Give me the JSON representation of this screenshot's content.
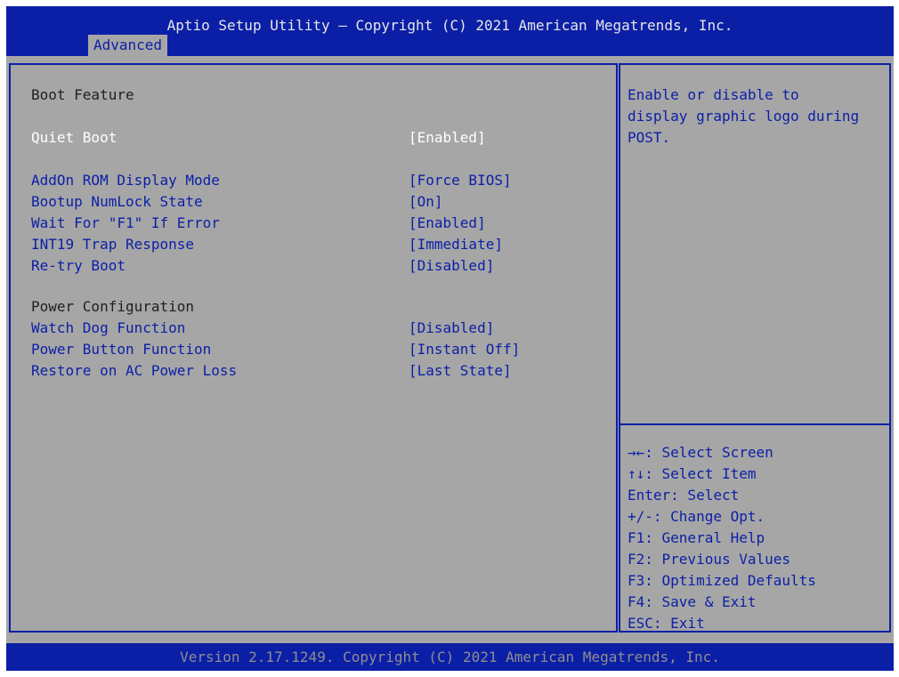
{
  "header": {
    "title": "Aptio Setup Utility – Copyright (C) 2021 American Megatrends, Inc.",
    "active_tab": "Advanced"
  },
  "main": {
    "section_boot": "Boot Feature",
    "quiet_boot": {
      "label": "Quiet Boot",
      "value": "[Enabled]"
    },
    "addon_rom": {
      "label": "AddOn ROM Display Mode",
      "value": "[Force BIOS]"
    },
    "numlock": {
      "label": "Bootup NumLock State",
      "value": "[On]"
    },
    "wait_f1": {
      "label": "Wait For \"F1\" If Error",
      "value": "[Enabled]"
    },
    "int19": {
      "label": "INT19 Trap Response",
      "value": "[Immediate]"
    },
    "retry_boot": {
      "label": "Re-try Boot",
      "value": "[Disabled]"
    },
    "section_power": "Power Configuration",
    "watchdog": {
      "label": "Watch Dog Function",
      "value": "[Disabled]"
    },
    "power_button": {
      "label": "Power Button Function",
      "value": "[Instant Off]"
    },
    "restore_ac": {
      "label": "Restore on AC Power Loss",
      "value": "[Last State]"
    }
  },
  "help": {
    "line1": "Enable or disable to",
    "line2": "display graphic logo during",
    "line3": "POST."
  },
  "keys": {
    "select_screen": "→←: Select Screen",
    "select_item": "↑↓: Select Item",
    "enter": "Enter: Select",
    "change": "+/-: Change Opt.",
    "f1": "F1: General Help",
    "f2": "F2: Previous Values",
    "f3": "F3: Optimized Defaults",
    "f4": "F4: Save & Exit",
    "esc": "ESC: Exit"
  },
  "footer": {
    "text": "Version 2.17.1249. Copyright (C) 2021 American Megatrends, Inc."
  },
  "colors": {
    "bar_blue": "#0b1fa6",
    "panel_gray": "#a6a6a6",
    "selected_text": "#ffffff"
  }
}
